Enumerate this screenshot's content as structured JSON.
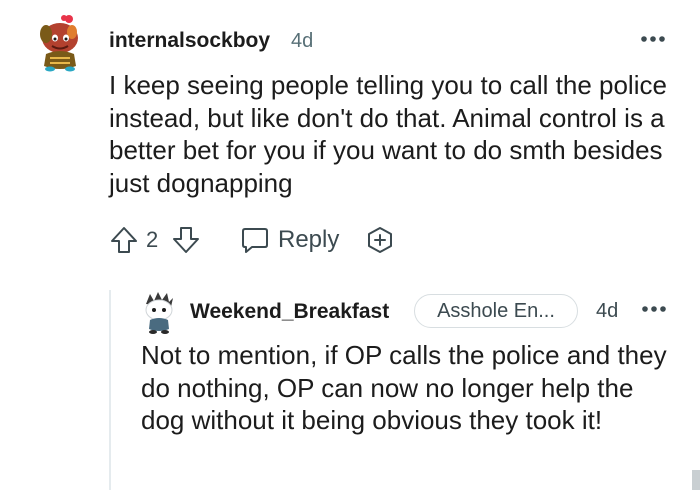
{
  "comment": {
    "username": "internalsockboy",
    "age": "4d",
    "more_icon": "ellipsis-icon",
    "body": "I keep seeing people telling you to call the police instead, but like don't do that. Animal control is a better bet for you if you want to do smth besides just dognapping",
    "score": "2",
    "reply_label": "Reply",
    "icons": {
      "upvote": "arrow-up-icon",
      "downvote": "arrow-down-icon",
      "reply": "speech-bubble-icon",
      "award": "plus-circle-icon"
    }
  },
  "reply": {
    "username": "Weekend_Breakfast",
    "flair": "Asshole En...",
    "age": "4d",
    "more_icon": "ellipsis-icon",
    "body": "Not to mention, if OP calls the police and they do nothing, OP can now no longer help the dog without it being obvious they took it!"
  },
  "colors": {
    "text": "#1c1c1c",
    "muted": "#576f76",
    "icon": "#3c4a50",
    "border": "#d8dee1"
  }
}
